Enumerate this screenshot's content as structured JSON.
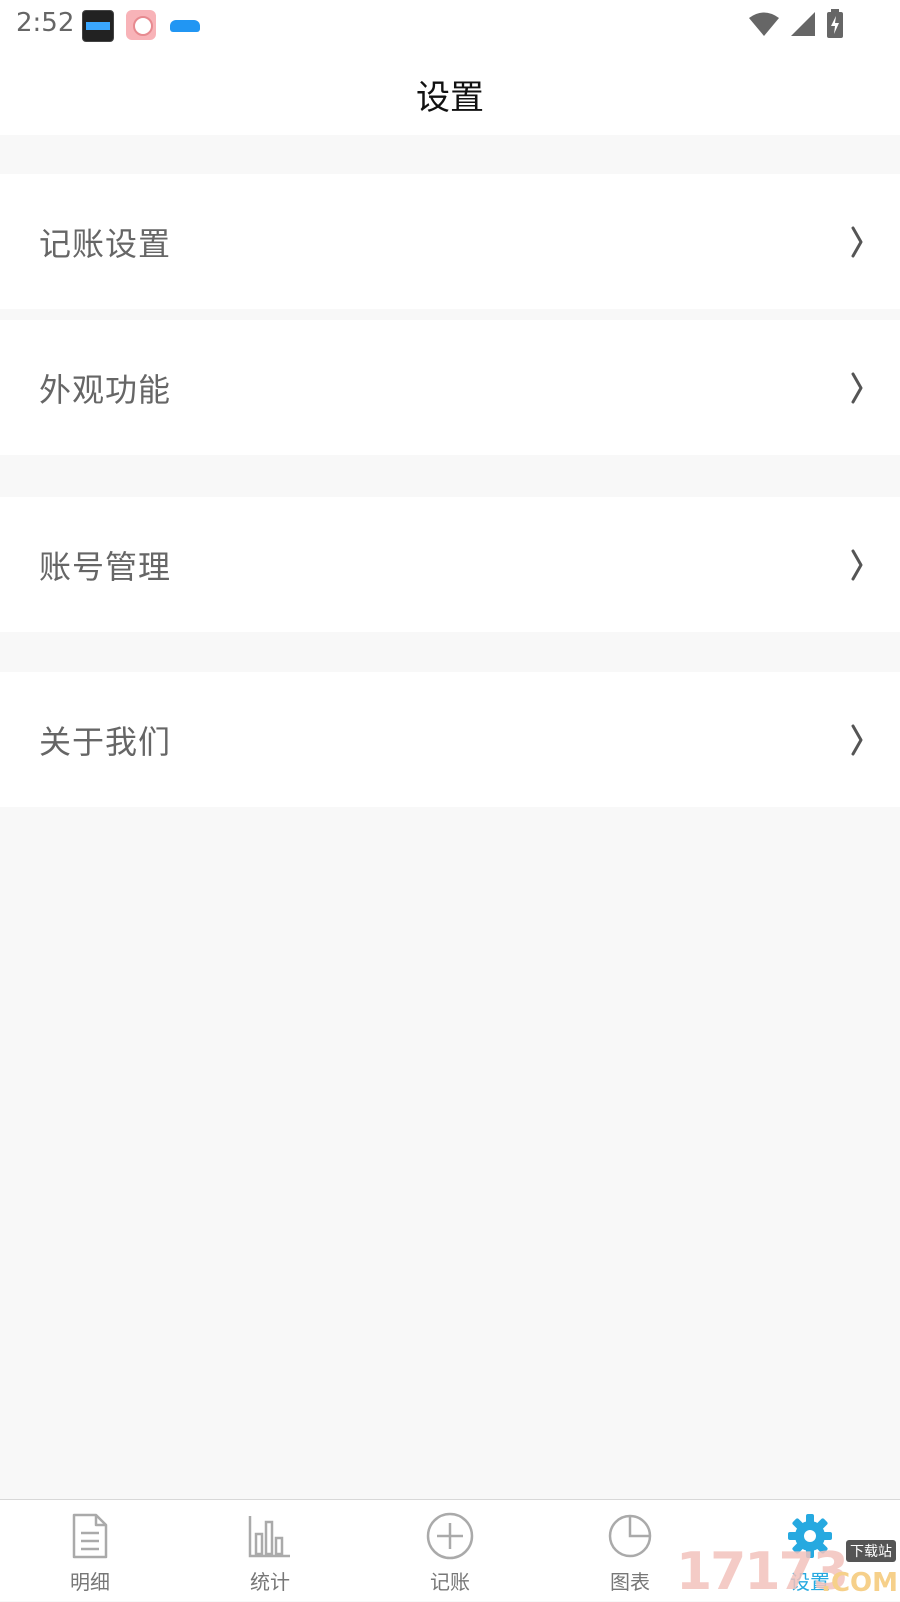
{
  "status_bar": {
    "time": "2:52",
    "app_icons": [
      "clock-widget-icon",
      "rice-app-icon",
      "car-app-icon"
    ],
    "system_icons": [
      "wifi-icon",
      "signal-icon",
      "battery-charging-icon"
    ]
  },
  "header": {
    "title": "设置"
  },
  "settings": {
    "items": [
      {
        "label": "记账设置"
      },
      {
        "label": "外观功能"
      },
      {
        "label": "账号管理"
      },
      {
        "label": "关于我们"
      }
    ]
  },
  "nav": {
    "items": [
      {
        "label": "明细",
        "icon": "document-icon"
      },
      {
        "label": "统计",
        "icon": "bar-chart-icon"
      },
      {
        "label": "记账",
        "icon": "plus-circle-icon"
      },
      {
        "label": "图表",
        "icon": "pie-chart-icon"
      },
      {
        "label": "设置",
        "icon": "gear-icon",
        "active": true
      }
    ],
    "active_color": "#26a9e0",
    "inactive_color": "#777777"
  },
  "watermark": {
    "number": "17173",
    "tag": "下载站",
    "suffix": ".COM"
  }
}
